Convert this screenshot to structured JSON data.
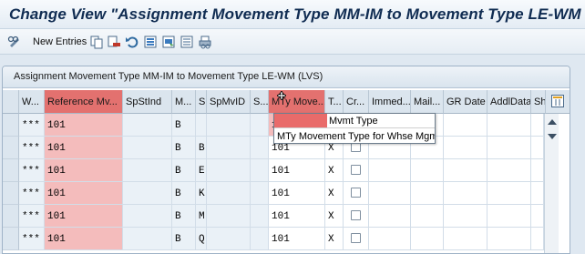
{
  "window": {
    "title": "Change View \"Assignment Movement Type MM-IM to Movement Type LE-WM (LV"
  },
  "toolbar": {
    "new_entries_label": "New Entries",
    "icons": [
      "edit-glasses-icon",
      "copy-icon",
      "delete-icon",
      "undo-icon",
      "select-all-icon",
      "select-block-icon",
      "deselect-all-icon",
      "print-icon"
    ]
  },
  "panel": {
    "title": "Assignment Movement Type MM-IM to Movement Type LE-WM (LVS)"
  },
  "table": {
    "columns": [
      {
        "key": "w",
        "label": "W..."
      },
      {
        "key": "ref",
        "label": "Reference Mv..."
      },
      {
        "key": "spst",
        "label": "SpStInd"
      },
      {
        "key": "m",
        "label": "M..."
      },
      {
        "key": "s",
        "label": "S"
      },
      {
        "key": "spmv",
        "label": "SpMvID"
      },
      {
        "key": "s2",
        "label": "S..."
      },
      {
        "key": "mty",
        "label": "MTy Move..."
      },
      {
        "key": "t",
        "label": "T..."
      },
      {
        "key": "cr",
        "label": "Cr..."
      },
      {
        "key": "immed",
        "label": "Immed..."
      },
      {
        "key": "mail",
        "label": "Mail..."
      },
      {
        "key": "gr",
        "label": "GR Date"
      },
      {
        "key": "addl",
        "label": "AddlData"
      },
      {
        "key": "sh",
        "label": "Sh"
      }
    ],
    "rows": [
      {
        "w": "***",
        "ref": "101",
        "m": "B",
        "s": "",
        "mty": "1",
        "t": ""
      },
      {
        "w": "***",
        "ref": "101",
        "m": "B",
        "s": "B",
        "mty": "101",
        "t": "X"
      },
      {
        "w": "***",
        "ref": "101",
        "m": "B",
        "s": "E",
        "mty": "101",
        "t": "X"
      },
      {
        "w": "***",
        "ref": "101",
        "m": "B",
        "s": "K",
        "mty": "101",
        "t": "X"
      },
      {
        "w": "***",
        "ref": "101",
        "m": "B",
        "s": "M",
        "mty": "101",
        "t": "X"
      },
      {
        "w": "***",
        "ref": "101",
        "m": "B",
        "s": "Q",
        "mty": "101",
        "t": "X"
      }
    ]
  },
  "tooltip": {
    "line1": "Mvmt Type",
    "line2": "MTy Movement Type for Whse Mgmt"
  },
  "colors": {
    "selection": "#e3716f",
    "title": "#102c52"
  }
}
